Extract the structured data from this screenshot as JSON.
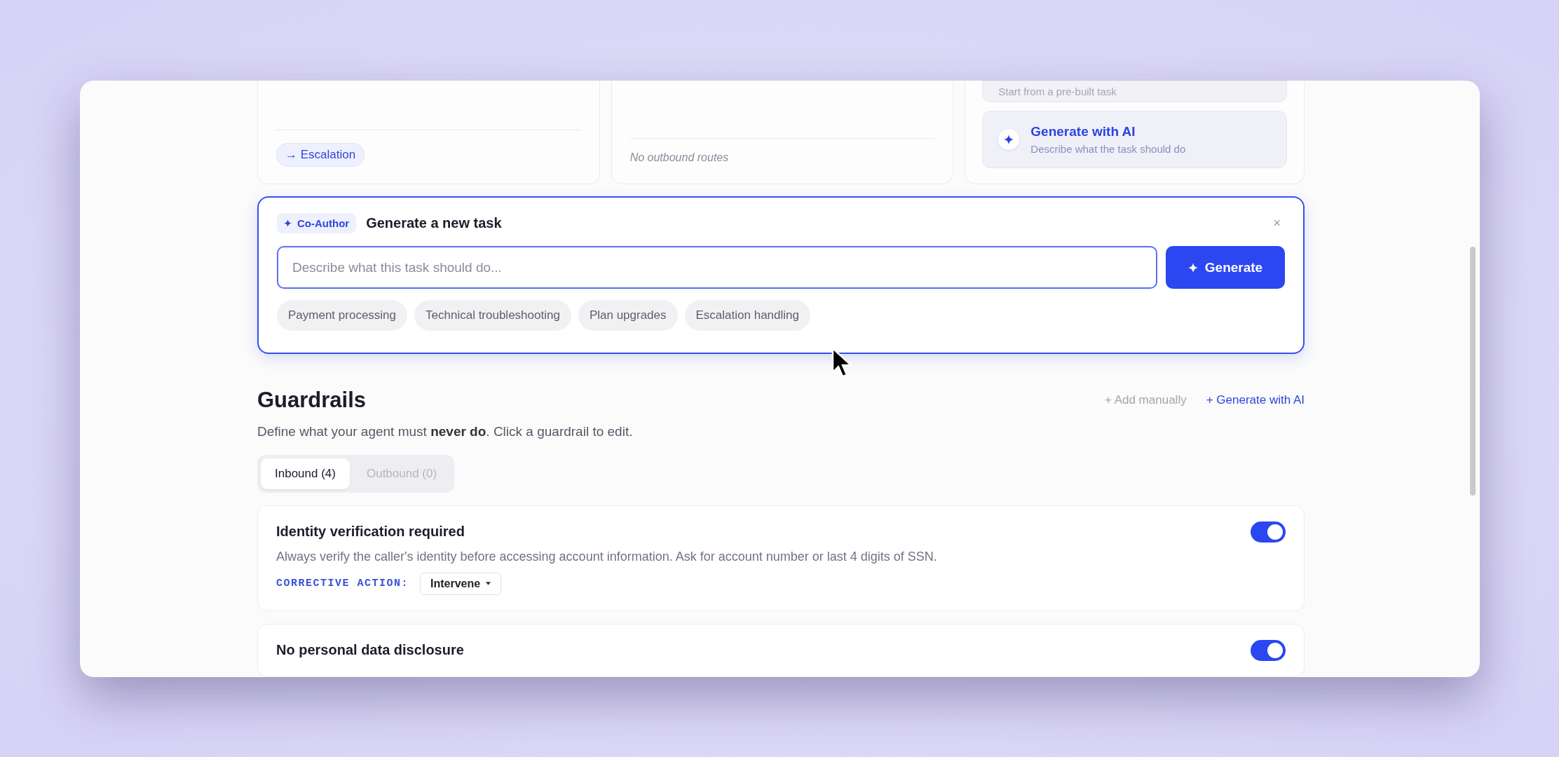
{
  "route_cards": [
    {
      "kind": "chip",
      "text": "→ Escalation"
    },
    {
      "kind": "empty",
      "text": "No outbound routes"
    },
    {
      "kind": "options",
      "options": [
        {
          "kind": "template",
          "subtitle": "Start from a pre-built task"
        },
        {
          "kind": "ai",
          "title": "Generate with AI",
          "subtitle": "Describe what the task should do"
        }
      ]
    }
  ],
  "co_author": {
    "badge": "Co-Author",
    "title": "Generate a new task",
    "close": "×",
    "input": {
      "placeholder": "Describe what this task should do..."
    },
    "button": "Generate",
    "suggestions": [
      "Payment processing",
      "Technical troubleshooting",
      "Plan upgrades",
      "Escalation handling"
    ]
  },
  "guardrails": {
    "title": "Guardrails",
    "subtitle": "Define what your agent must **never do**. Click a guardrail to edit.",
    "actions": [
      {
        "kind": "manual",
        "label": "+ Add manually"
      },
      {
        "kind": "ai",
        "label": "+ Generate with AI"
      }
    ],
    "tabs": [
      {
        "label": "Inbound (4)",
        "selected": true
      },
      {
        "label": "Outbound (0)",
        "selected": false
      }
    ],
    "items": [
      {
        "title": "Identity verification required",
        "description": "Always verify the caller's identity before accessing account information. Ask for account number or last 4 digits of SSN.",
        "action_label": "CORRECTIVE ACTION:",
        "action_value": "Intervene",
        "on": true
      },
      {
        "title": "No personal data disclosure",
        "on": true
      }
    ]
  }
}
